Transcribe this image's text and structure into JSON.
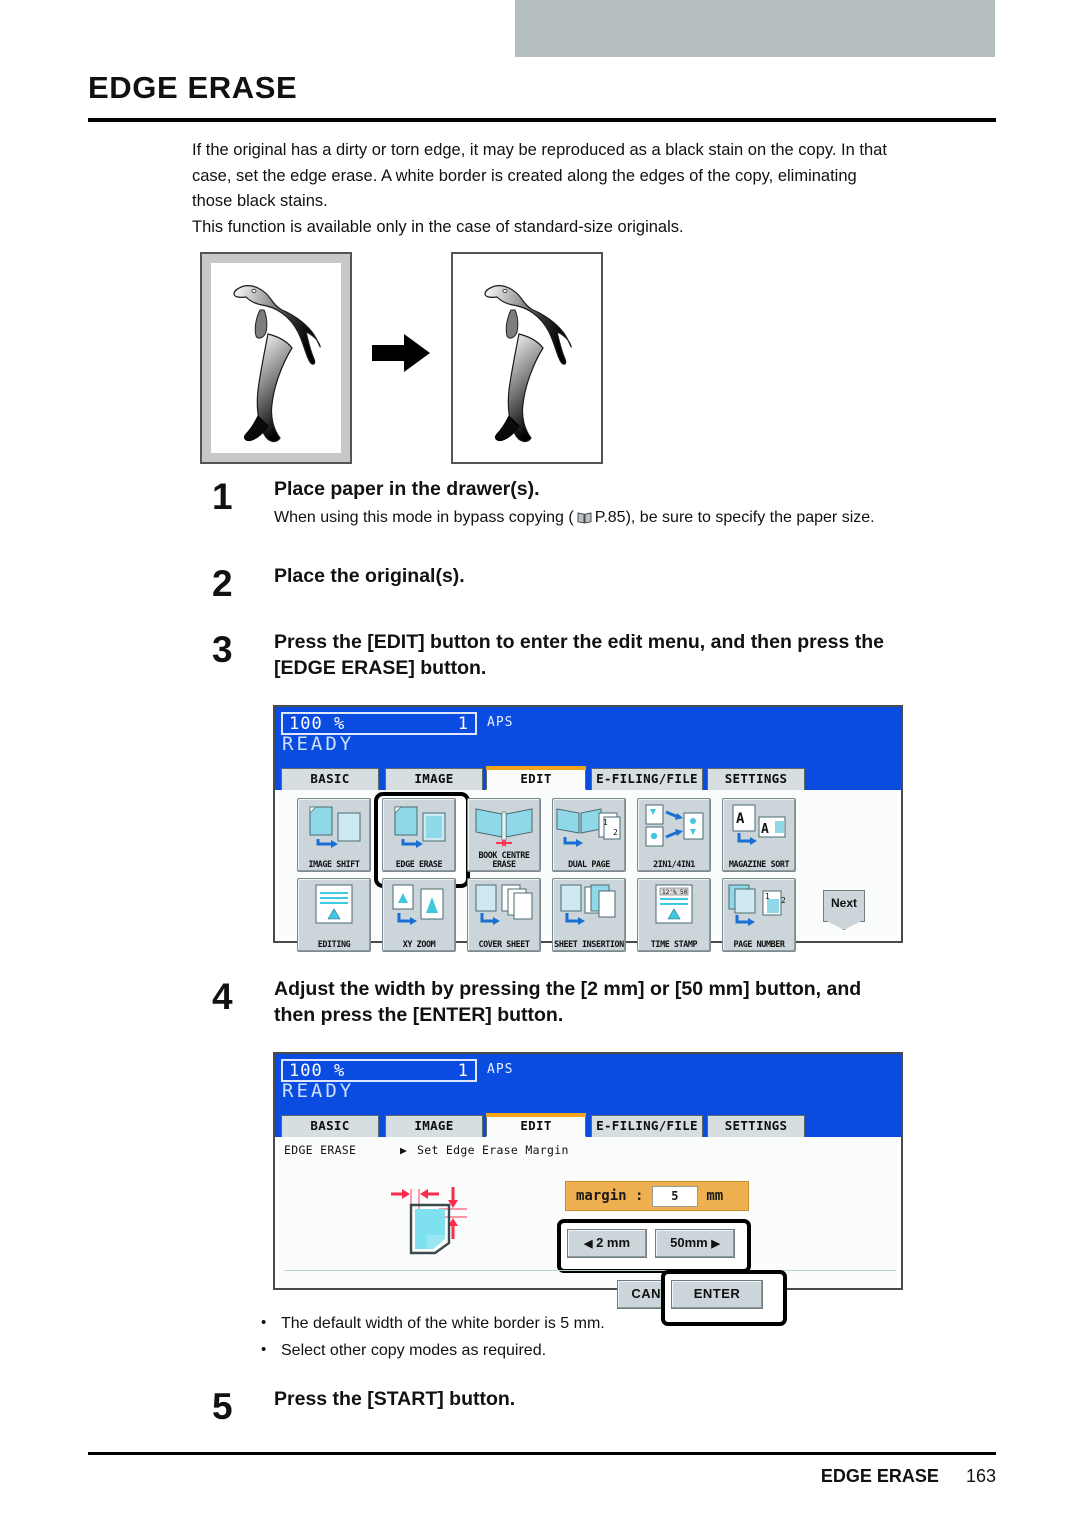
{
  "header": {
    "title": "EDGE ERASE"
  },
  "intro": {
    "line1": "If the original has a dirty or torn edge, it may be reproduced as a black stain on the copy. In that",
    "line2": "case, set the edge erase. A white border is created along the edges of the copy, eliminating",
    "line3": "those black stains.",
    "line4": "This function is available only in the case of standard-size originals."
  },
  "illustration": {
    "before_label": "original-with-black-edge",
    "after_label": "copy-with-white-border",
    "arrow": "arrow-right-icon"
  },
  "steps": [
    {
      "num": "1",
      "heading": "Place paper in the drawer(s).",
      "sub_before": "When using this mode in bypass copying (",
      "sub_ref": "P.85",
      "sub_after": "), be sure to specify the paper size."
    },
    {
      "num": "2",
      "heading": "Place the original(s)."
    },
    {
      "num": "3",
      "heading_line1": "Press the [EDIT] button to enter the edit menu, and then press the",
      "heading_line2": "[EDGE ERASE] button."
    },
    {
      "num": "4",
      "heading_line1": "Adjust the width by pressing the [2 mm] or [50 mm] button, and",
      "heading_line2": "then press the [ENTER] button."
    },
    {
      "num": "5",
      "heading": "Press the [START] button."
    }
  ],
  "notes": [
    "The default width of the white border is 5 mm.",
    "Select other copy modes as required."
  ],
  "panel1": {
    "ratio": "100  %",
    "percent_sign": "%",
    "copies": "1",
    "paper_mode": "APS",
    "status": "READY",
    "tabs": [
      {
        "label": "BASIC",
        "active": false
      },
      {
        "label": "IMAGE",
        "active": false
      },
      {
        "label": "EDIT",
        "active": true
      },
      {
        "label": "E-FILING/FILE",
        "active": false
      },
      {
        "label": "SETTINGS",
        "active": false
      }
    ],
    "tiles_row1": [
      {
        "label": "IMAGE SHIFT",
        "icon": "image-shift-icon",
        "selected": false
      },
      {
        "label": "EDGE ERASE",
        "icon": "edge-erase-icon",
        "selected": true
      },
      {
        "label": "BOOK CENTRE ERASE",
        "icon": "book-centre-erase-icon",
        "selected": false
      },
      {
        "label": "DUAL  PAGE",
        "icon": "dual-page-icon",
        "selected": false
      },
      {
        "label": "2IN1/4IN1",
        "icon": "2in1-4in1-icon",
        "selected": false
      },
      {
        "label": "MAGAZINE SORT",
        "icon": "magazine-sort-icon",
        "selected": false
      }
    ],
    "tiles_row2": [
      {
        "label": "EDITING",
        "icon": "editing-icon",
        "selected": false
      },
      {
        "label": "XY ZOOM",
        "icon": "xy-zoom-icon",
        "selected": false
      },
      {
        "label": "COVER SHEET",
        "icon": "cover-sheet-icon",
        "selected": false
      },
      {
        "label": "SHEET INSERTION",
        "icon": "sheet-insertion-icon",
        "selected": false
      },
      {
        "label": "TIME STAMP",
        "icon": "time-stamp-icon",
        "selected": false
      },
      {
        "label": "PAGE NUMBER",
        "icon": "page-number-icon",
        "selected": false
      }
    ],
    "next_label": "Next"
  },
  "panel2": {
    "ratio": "100  %",
    "copies": "1",
    "paper_mode": "APS",
    "status": "READY",
    "tabs": [
      {
        "label": "BASIC",
        "active": false
      },
      {
        "label": "IMAGE",
        "active": false
      },
      {
        "label": "EDIT",
        "active": true
      },
      {
        "label": "E-FILING/FILE",
        "active": false
      },
      {
        "label": "SETTINGS",
        "active": false
      }
    ],
    "breadcrumb_mode": "EDGE ERASE",
    "breadcrumb_action": "Set Edge Erase Margin",
    "margin_label": "margin  :",
    "margin_value": "5",
    "margin_unit": "mm",
    "decrease_label": "2 mm",
    "increase_label": "50mm",
    "cancel_label": "CANCEL",
    "enter_label": "ENTER",
    "diagram": "edge-erase-margin-diagram"
  },
  "footer": {
    "section": "EDGE ERASE",
    "page": "163"
  }
}
